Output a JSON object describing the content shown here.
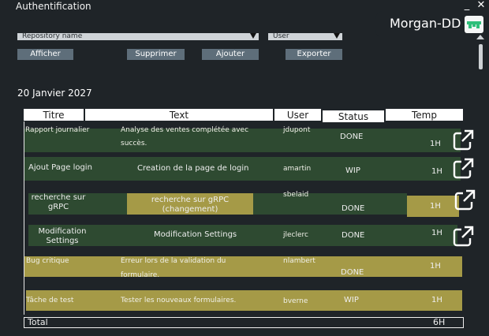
{
  "window": {
    "title": "Authentification",
    "minimize": "_",
    "close": "✕"
  },
  "brand": {
    "name": "Morgan-DD",
    "logo_icon": "brand-logo-icon"
  },
  "filters": {
    "repository": "Repository name",
    "user": "User"
  },
  "toolbar": {
    "afficher": "Afficher",
    "supprimer": "Supprimer",
    "ajouter": "Ajouter",
    "exporter": "Exporter"
  },
  "date": "20 Janvier 2027",
  "table": {
    "headers": {
      "titre": "Titre",
      "text": "Text",
      "user": "User",
      "status": "Status",
      "temp": "Temp"
    },
    "rows": [
      {
        "titre": "Rapport journalier",
        "text1": "Analyse des ventes complétée avec",
        "text2": "succès.",
        "user": "jdupont",
        "status": "DONE",
        "temp": "1H"
      },
      {
        "titre": "Ajout Page login",
        "text": "Creation de la page de login",
        "user": "amartin",
        "status": "WIP",
        "temp": "1H"
      },
      {
        "titre1": "recherche sur",
        "titre2": "gRPC",
        "text1": "recherche sur  gRPC",
        "text2": "(changement)",
        "user": "sbelaid",
        "status": "DONE",
        "temp": "1H"
      },
      {
        "titre1": "Modification",
        "titre2": "Settings",
        "text": "Modification Settings",
        "user": "jleclerc",
        "status": "DONE",
        "temp": "1H"
      },
      {
        "titre": "Bug critique",
        "text1": "Erreur lors de la validation du",
        "text2": "formulaire.",
        "user": "nlambert",
        "status": "DONE",
        "temp": "1H"
      },
      {
        "titre": "Tâche de test",
        "text": "Tester les nouveaux formulaires.",
        "user": "bverne",
        "status": "WIP",
        "temp": "1H"
      }
    ],
    "total_label": "Total",
    "total_value": "6H"
  },
  "colors": {
    "background": "#1f2428",
    "done_row": "#2e4a31",
    "highlight": "#a59a47",
    "button": "#5e6e7a"
  }
}
